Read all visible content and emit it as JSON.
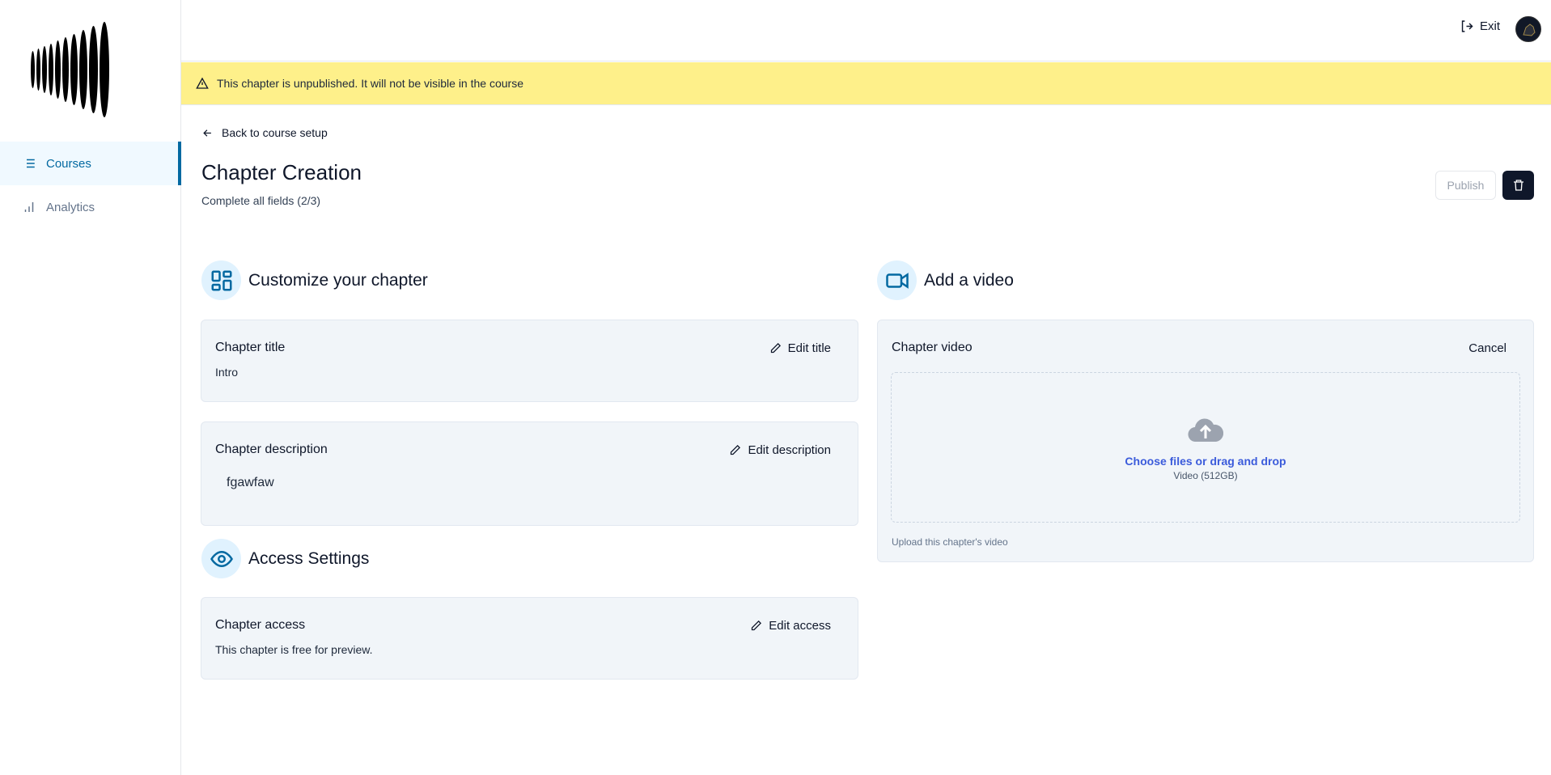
{
  "sidebar": {
    "items": [
      {
        "label": "Courses",
        "icon": "list-icon",
        "active": true
      },
      {
        "label": "Analytics",
        "icon": "bar-chart-icon",
        "active": false
      }
    ]
  },
  "topbar": {
    "exit_label": "Exit"
  },
  "banner": {
    "text": "This chapter is unpublished. It will not be visible in the course"
  },
  "header": {
    "back_label": "Back to course setup",
    "title": "Chapter Creation",
    "subtitle": "Complete all fields (2/3)",
    "publish_label": "Publish"
  },
  "customize": {
    "heading": "Customize your chapter",
    "title_card": {
      "label": "Chapter title",
      "edit": "Edit title",
      "value": "Intro"
    },
    "desc_card": {
      "label": "Chapter description",
      "edit": "Edit description",
      "value": "fgawfaw"
    }
  },
  "access": {
    "heading": "Access Settings",
    "card": {
      "label": "Chapter access",
      "edit": "Edit access",
      "value": "This chapter is free for preview."
    }
  },
  "video": {
    "heading": "Add a video",
    "label": "Chapter video",
    "cancel": "Cancel",
    "choose": "Choose files or drag and drop",
    "hint": "Video (512GB)",
    "footer": "Upload this chapter's video"
  },
  "colors": {
    "accent": "#0369a1",
    "banner": "#fef08a",
    "link": "#3b5bdb",
    "dark": "#0f172a"
  }
}
